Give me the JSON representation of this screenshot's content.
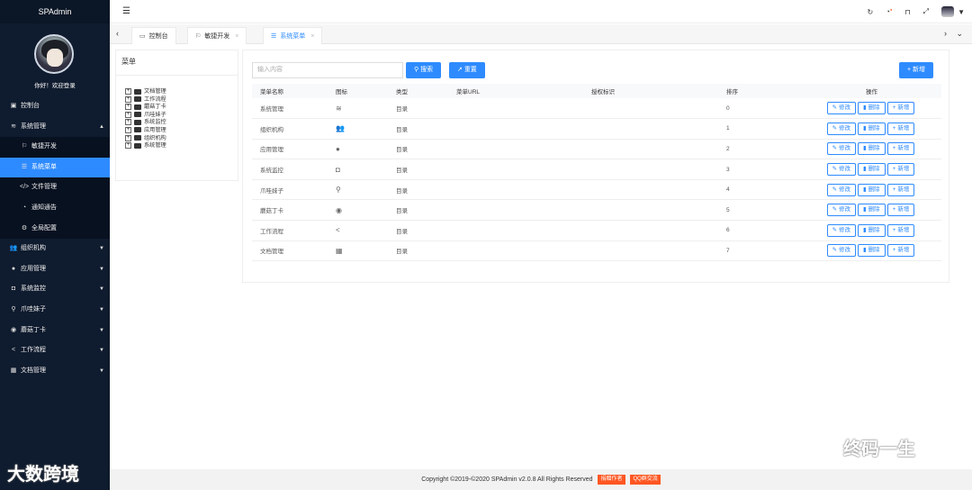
{
  "brand": "SPAdmin",
  "user": {
    "greeting": "你好！欢迎登录"
  },
  "sidebar": [
    {
      "label": "控制台",
      "icon": "dashboard-icon",
      "glyph": "▣"
    },
    {
      "label": "系统管理",
      "icon": "layers-icon",
      "glyph": "≋",
      "caret": "▲"
    },
    {
      "label": "组织机构",
      "icon": "users-icon",
      "glyph": "👥",
      "caret": "▼"
    },
    {
      "label": "应用管理",
      "icon": "compass-icon",
      "glyph": "●",
      "caret": "▼"
    },
    {
      "label": "系统监控",
      "icon": "camera-icon",
      "glyph": "◘",
      "caret": "▼"
    },
    {
      "label": "爪哇妹子",
      "icon": "search-icon",
      "glyph": "⚲",
      "caret": "▼"
    },
    {
      "label": "蘑菇丁卡",
      "icon": "location-icon",
      "glyph": "◉",
      "caret": "▼"
    },
    {
      "label": "工作流程",
      "icon": "share-icon",
      "glyph": "<",
      "caret": "▼"
    },
    {
      "label": "文档管理",
      "icon": "calendar-icon",
      "glyph": "▦",
      "caret": "▼"
    }
  ],
  "submenu": [
    {
      "label": "敏捷开发",
      "icon": "flag-icon",
      "glyph": "⚐"
    },
    {
      "label": "系统菜单",
      "icon": "menu-list-icon",
      "glyph": "☰"
    },
    {
      "label": "文件管理",
      "icon": "code-icon",
      "glyph": "</>"
    },
    {
      "label": "通知通告",
      "icon": "bell-icon",
      "glyph": "◔"
    },
    {
      "label": "全局配置",
      "icon": "sliders-icon",
      "glyph": "⚙"
    }
  ],
  "tabs": [
    {
      "label": "控制台",
      "icon": "monitor-icon",
      "glyph": "▭",
      "closable": false
    },
    {
      "label": "敏捷开发",
      "icon": "flag-icon",
      "glyph": "⚐",
      "closable": true
    },
    {
      "label": "系统菜单",
      "icon": "menu-list-icon",
      "glyph": "☰",
      "closable": true,
      "active": true
    }
  ],
  "tree": {
    "title": "菜单",
    "nodes": [
      "文档管理",
      "工作流程",
      "蘑菇丁卡",
      "爪哇妹子",
      "系统监控",
      "应用管理",
      "组织机构",
      "系统管理"
    ]
  },
  "toolbar": {
    "search_placeholder": "输入内容",
    "search": "搜索",
    "reset": "重置",
    "add": "新增"
  },
  "table": {
    "columns": [
      "菜单名称",
      "图标",
      "类型",
      "菜单URL",
      "授权标识",
      "排序",
      "操作"
    ],
    "rows": [
      {
        "name": "系统管理",
        "icon": "layers-icon",
        "glyph": "≋",
        "type": "目录",
        "url": "",
        "perm": "",
        "order": "0"
      },
      {
        "name": "组织机构",
        "icon": "users-icon",
        "glyph": "👥",
        "type": "目录",
        "url": "",
        "perm": "",
        "order": "1"
      },
      {
        "name": "应用管理",
        "icon": "compass-icon",
        "glyph": "●",
        "type": "目录",
        "url": "",
        "perm": "",
        "order": "2"
      },
      {
        "name": "系统监控",
        "icon": "camera-icon",
        "glyph": "◘",
        "type": "目录",
        "url": "",
        "perm": "",
        "order": "3"
      },
      {
        "name": "爪哇妹子",
        "icon": "search-icon",
        "glyph": "⚲",
        "type": "目录",
        "url": "",
        "perm": "",
        "order": "4"
      },
      {
        "name": "蘑菇丁卡",
        "icon": "location-icon",
        "glyph": "◉",
        "type": "目录",
        "url": "",
        "perm": "",
        "order": "5"
      },
      {
        "name": "工作流程",
        "icon": "share-icon",
        "glyph": "<",
        "type": "目录",
        "url": "",
        "perm": "",
        "order": "6"
      },
      {
        "name": "文档管理",
        "icon": "calendar-icon",
        "glyph": "▦",
        "type": "目录",
        "url": "",
        "perm": "",
        "order": "7"
      }
    ],
    "actions": {
      "edit": "修改",
      "delete": "删除",
      "add": "新增"
    }
  },
  "footer": {
    "text": "Copyright ©2019-©2020 SPAdmin v2.0.8 All Rights Reserved",
    "tag1": "捐赠作者",
    "tag2": "QQ群交流"
  },
  "watermarks": {
    "left": "大数跨境",
    "right": "终码一生"
  },
  "colors": {
    "sidebar": "#0f1b2e",
    "accent": "#2e8bff",
    "footer_tag": "#ff5722"
  }
}
